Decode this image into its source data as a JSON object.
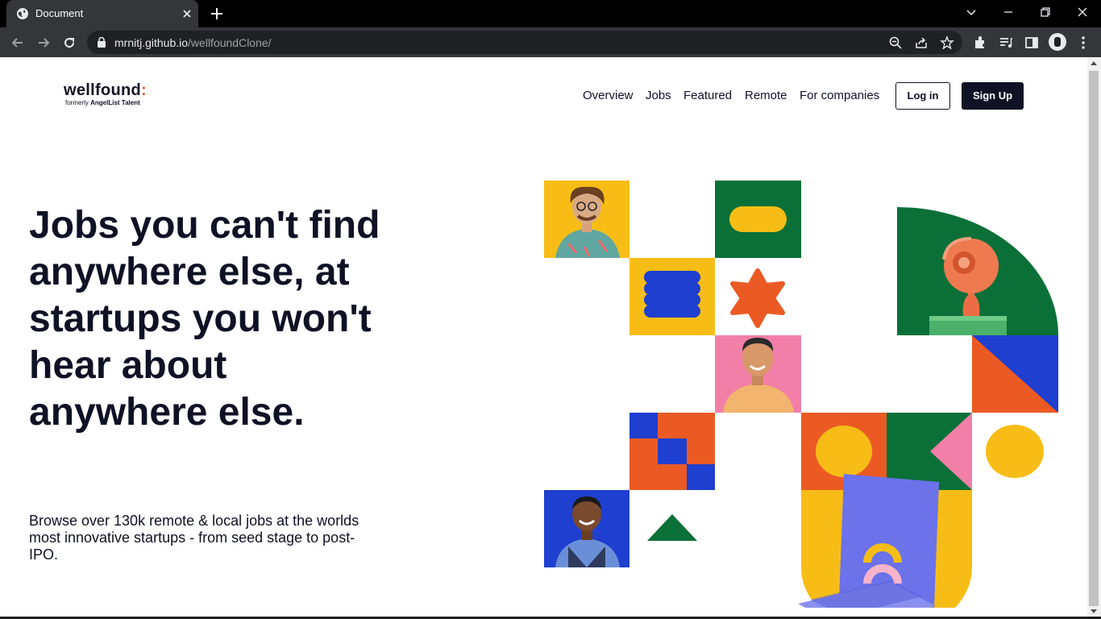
{
  "browser": {
    "tab_title": "Document",
    "url_host": "mrnitj.github.io",
    "url_path": "/wellfoundClone/"
  },
  "logo": {
    "wordmark": "wellfound",
    "wordmark_accent": ":",
    "tagline_prefix": "formerly ",
    "tagline_brand": "AngelList Talent"
  },
  "nav": {
    "items": [
      "Overview",
      "Jobs",
      "Featured",
      "Remote",
      "For companies"
    ],
    "login": "Log in",
    "signup": "Sign Up"
  },
  "hero": {
    "headline": "Jobs you can't find anywhere else, at startups you won't hear about anywhere else.",
    "subtext": "Browse over 130k remote & local jobs at the worlds most innovative startups - from seed stage to post-IPO."
  },
  "colors": {
    "navy": "#0f1225",
    "yellow": "#f7bd16",
    "green": "#0a7038",
    "blue": "#1e3fcf",
    "orange": "#ec5a24",
    "pink": "#f27fa8",
    "accent": "#e8562a"
  }
}
